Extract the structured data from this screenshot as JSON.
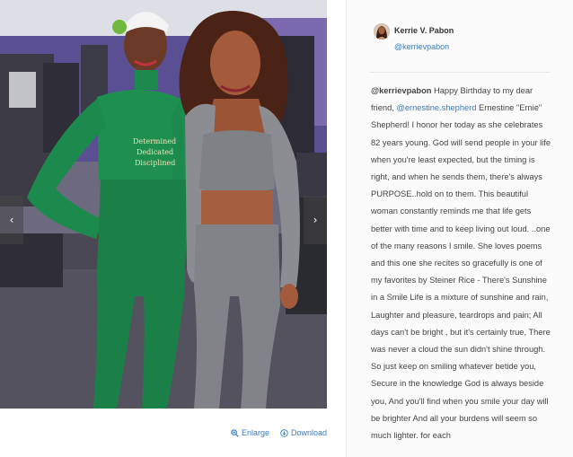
{
  "viewer": {
    "prev_arrow": "‹",
    "next_arrow": "›"
  },
  "actions": {
    "enlarge_label": "Enlarge",
    "download_label": "Download"
  },
  "post": {
    "author_name": "Kerrie V. Pabon",
    "author_handle": "@kerrievpabon",
    "caption_author_mention": "@kerrievpabon",
    "caption_intro": " Happy Birthday to my dear friend, ",
    "caption_mention_2": "@ernestine.shepherd",
    "caption_text": " Ernestine \"Ernie\" Shepherd! I honor her today as she celebrates 82 years young. God will send people in your life when you're least expected, but the timing is right, and when he sends them, there's always PURPOSE..hold on to them. This beautiful woman constantly reminds me that life gets better with time and to keep living out loud. ..one of the many reasons I smile. She loves poems and this one she recites so gracefully is one of my favorites by Steiner Rice - There's Sunshine in a Smile Life is a mixture of sunshine and rain, Laughter and pleasure, teardrops and pain; All days can't be bright , but it's certainly true, There was never a cloud the sun didn't shine through. So just keep on smiling whatever betide you, Secure in the knowledge God is always beside you, And you'll find when you smile your day will be brighter And all your burdens will seem so much lighter. for each"
  },
  "colors": {
    "link": "#3b7bc0",
    "text": "#444444",
    "panel_bg": "#fbfbfb",
    "gym_purple": "#6a5e9e",
    "tracksuit_green": "#1d8a4d"
  }
}
